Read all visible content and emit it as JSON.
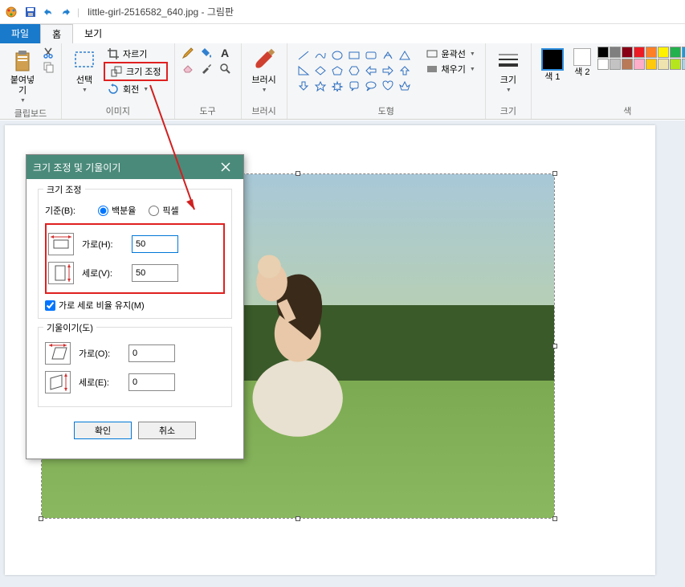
{
  "title": {
    "filename": "little-girl-2516582_640.jpg",
    "app_name": "그림판"
  },
  "tabs": {
    "file": "파일",
    "home": "홈",
    "view": "보기"
  },
  "ribbon": {
    "clipboard": {
      "label": "클립보드",
      "paste": "붙여넣기"
    },
    "image": {
      "label": "이미지",
      "select": "선택",
      "crop": "자르기",
      "resize": "크기 조정",
      "rotate": "회전"
    },
    "tools": {
      "label": "도구"
    },
    "brushes": {
      "label": "브러시",
      "btn": "브러시"
    },
    "shapes": {
      "label": "도형",
      "outline": "윤곽선",
      "fill": "채우기"
    },
    "size": {
      "label": "크기",
      "btn": "크기"
    },
    "colors": {
      "label": "색",
      "color1": "색 1",
      "color2": "색 2"
    }
  },
  "palette": {
    "row1": [
      "#000000",
      "#7f7f7f",
      "#880015",
      "#ed1c24",
      "#ff7f27",
      "#fff200",
      "#22b14c",
      "#00a2e8",
      "#3f48cc",
      "#a349a4"
    ],
    "row2": [
      "#ffffff",
      "#c3c3c3",
      "#b97a57",
      "#ffaec9",
      "#ffc90e",
      "#efe4b0",
      "#b5e61d",
      "#99d9ea",
      "#7092be",
      "#c8bfe7"
    ]
  },
  "dialog": {
    "title": "크기 조정 및 기울이기",
    "resize_section": "크기 조정",
    "basis_label": "기준(B):",
    "percent": "백분율",
    "pixel": "픽셀",
    "horizontal_h": "가로(H):",
    "vertical_v": "세로(V):",
    "h_value": "50",
    "v_value": "50",
    "maintain_ratio": "가로 세로 비율 유지(M)",
    "skew_section": "기울이기(도)",
    "horizontal_o": "가로(O):",
    "vertical_e": "세로(E):",
    "skew_h": "0",
    "skew_v": "0",
    "ok": "확인",
    "cancel": "취소"
  }
}
